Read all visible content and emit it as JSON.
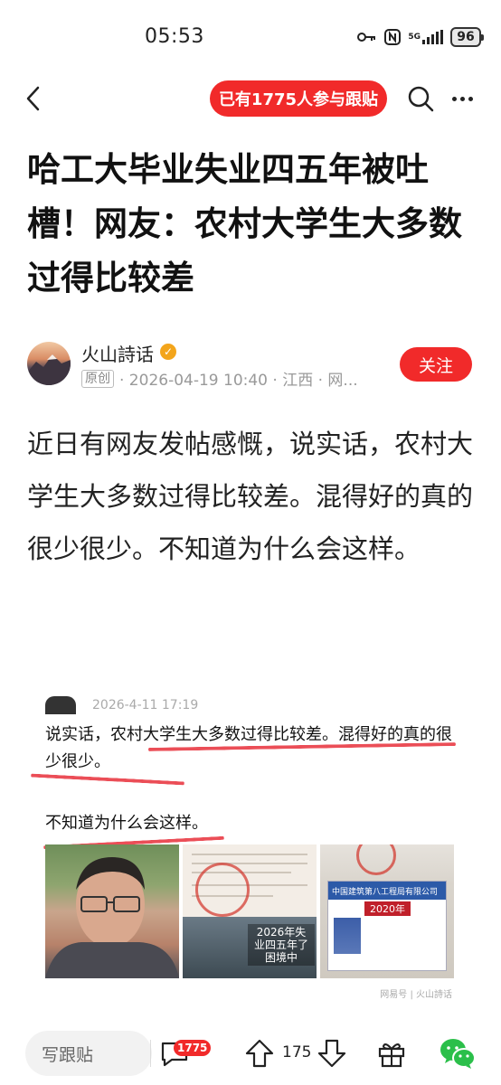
{
  "status_bar": {
    "time": "05:53",
    "network": "5G",
    "battery": "96",
    "icons": [
      "key-icon",
      "nfc-icon",
      "signal-icon",
      "battery-icon"
    ]
  },
  "nav": {
    "back_icon": "chevron-left-icon",
    "follow_pill": "已有1775人参与跟贴",
    "search_icon": "search-icon",
    "more_icon": "more-horizontal-icon"
  },
  "article": {
    "title": "哈工大毕业失业四五年被吐槽！网友：农村大学生大多数过得比较差",
    "author": {
      "name": "火山詩话",
      "original_tag": "原创",
      "meta": "· 2026-04-19 10:40 · 江西 · 网...",
      "follow_label": "关注"
    },
    "body": "近日有网友发帖感慨，说实话，农村大学生大多数过得比较差。混得好的真的很少很少。不知道为什么会这样。"
  },
  "embed": {
    "date": "2026-4-11 17:19",
    "text1": "说实话，农村大学生大多数过得比较差。混得好的真的很少很少。",
    "text2": "不知道为什么会这样。",
    "overlay_caption": "2026年失业四五年了困境中",
    "card_company": "中国建筑第八工程局有限公司",
    "card_year": "2020年",
    "watermark": "网易号 | 火山詩话"
  },
  "bottom_bar": {
    "comment_placeholder": "写跟贴",
    "comment_count": "1775",
    "vote_count": "175",
    "icons": [
      "comment-icon",
      "arrow-up-icon",
      "arrow-down-icon",
      "gift-icon",
      "wechat-icon"
    ]
  },
  "colors": {
    "accent": "#f12a2a",
    "text": "#222222",
    "meta": "#999999",
    "verified": "#f3a51b"
  }
}
